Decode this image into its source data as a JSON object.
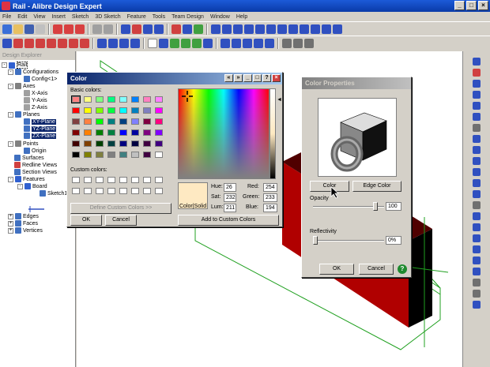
{
  "window": {
    "title": "Rail - Alibre Design Expert"
  },
  "menu": [
    "File",
    "Edit",
    "View",
    "Insert",
    "Sketch",
    "3D Sketch",
    "Feature",
    "Tools",
    "Team Design",
    "Window",
    "Help"
  ],
  "explorer": {
    "title": "Design Explorer",
    "items": [
      "Rail",
      "Configurations",
      "Config<1>",
      "Axes",
      "X-Axis",
      "Y-Axis",
      "Z-Axis",
      "Planes",
      "XY-Plane",
      "YZ-Plane",
      "ZX-Plane",
      "Points",
      "Origin",
      "Surfaces",
      "Redline Views",
      "Section Views",
      "Features",
      "Board",
      "Sketch1",
      "Edges",
      "Faces",
      "Vertices"
    ]
  },
  "color_dialog": {
    "title": "Color",
    "basic_label": "Basic colors:",
    "custom_label": "Custom colors:",
    "define_button": "Define Custom Colors >>",
    "ok": "OK",
    "cancel": "Cancel",
    "preview_label": "Color|Solid",
    "hue_label": "Hue:",
    "hue": "26",
    "sat_label": "Sat:",
    "sat": "232",
    "lum_label": "Lum:",
    "lum": "211",
    "red_label": "Red:",
    "red": "254",
    "green_label": "Green:",
    "green": "233",
    "blue_label": "Blue:",
    "blue": "194",
    "add_button": "Add to Custom Colors",
    "preview_color": "#fee9c2",
    "basic_colors": [
      "#ff8080",
      "#ffff80",
      "#80ff80",
      "#00ff80",
      "#80ffff",
      "#0080ff",
      "#ff80c0",
      "#ff80ff",
      "#ff0000",
      "#ffff00",
      "#80ff00",
      "#00ff40",
      "#00ffff",
      "#0080c0",
      "#8080c0",
      "#ff00ff",
      "#804040",
      "#ff8040",
      "#00ff00",
      "#008080",
      "#004080",
      "#8080ff",
      "#800040",
      "#ff0080",
      "#800000",
      "#ff8000",
      "#008000",
      "#008040",
      "#0000ff",
      "#0000a0",
      "#800080",
      "#8000ff",
      "#400000",
      "#804000",
      "#004000",
      "#004040",
      "#000080",
      "#000040",
      "#400040",
      "#400080",
      "#000000",
      "#808000",
      "#808040",
      "#808080",
      "#408080",
      "#c0c0c0",
      "#400040",
      "#ffffff"
    ]
  },
  "props_dialog": {
    "title": "Color Properties",
    "color_button": "Color",
    "edge_button": "Edge Color",
    "opacity_label": "Opacity",
    "opacity": "100",
    "reflect_label": "Reflectivity",
    "reflect": "0%",
    "ok": "OK",
    "cancel": "Cancel",
    "help": "?"
  }
}
